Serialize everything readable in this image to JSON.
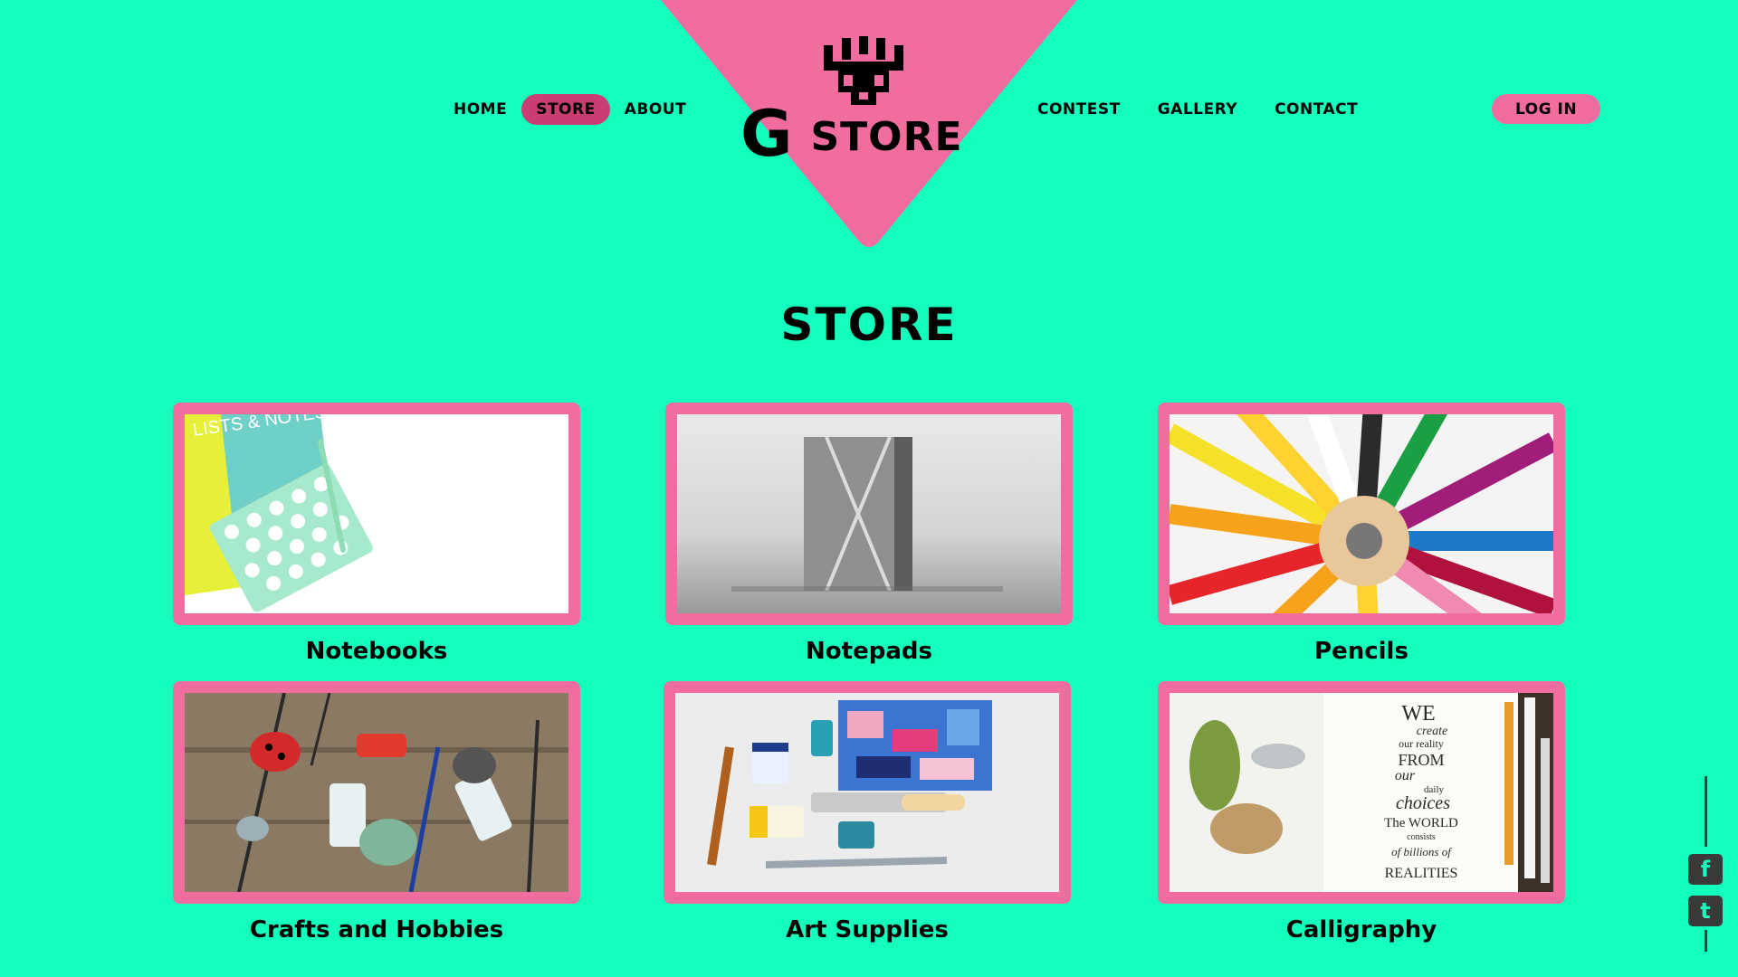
{
  "brand": {
    "logo_letter": "G",
    "logo_word": "STORE",
    "triangle_color": "#f26d9f",
    "background_color": "#14ffbd",
    "accent_active": "#c83e74"
  },
  "nav": {
    "left": [
      "HOME",
      "STORE",
      "ABOUT"
    ],
    "right": [
      "CONTEST",
      "GALLERY",
      "CONTACT"
    ],
    "active": "STORE",
    "login_label": "LOG IN"
  },
  "page_title": "STORE",
  "categories": [
    {
      "label": "Notebooks"
    },
    {
      "label": "Notepads"
    },
    {
      "label": "Pencils"
    },
    {
      "label": "Crafts and Hobbies"
    },
    {
      "label": "Art Supplies"
    },
    {
      "label": "Calligraphy"
    }
  ],
  "images": {
    "notebooks_cover_text": "LISTS & NOTES",
    "calligraphy_text": [
      "WE",
      "create",
      "our reality",
      "FROM",
      "our",
      "daily",
      "choices",
      "The WORLD",
      "consists",
      "of billions of",
      "REALITIES"
    ]
  },
  "social": {
    "icons": [
      "facebook-icon",
      "twitter-icon"
    ],
    "facebook_glyph": "f",
    "twitter_glyph": "t"
  }
}
